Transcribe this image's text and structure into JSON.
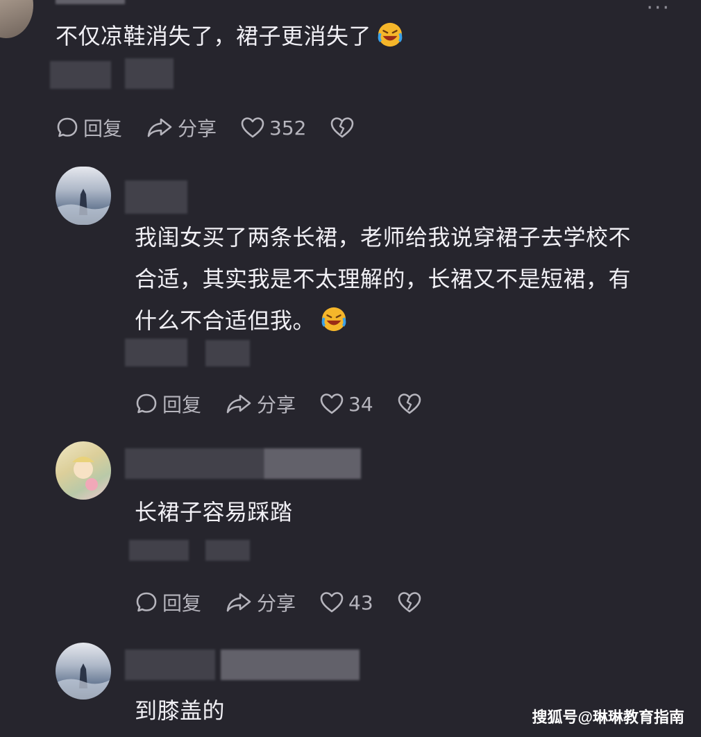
{
  "comments": [
    {
      "text": "不仅凉鞋消失了，裙子更消失了",
      "emoji": "laughing-crying-emoji",
      "reply_label": "回复",
      "share_label": "分享",
      "likes": "352"
    },
    {
      "text_lines": [
        "我闺女买了两条长裙，老师给我说穿裙子去学校不",
        "合适，其实我是不太理解的，长裙又不是短裙，有",
        "什么不合适但我。"
      ],
      "emoji": "laughing-crying-emoji",
      "reply_label": "回复",
      "share_label": "分享",
      "likes": "34"
    },
    {
      "text": "长裙子容易踩踏",
      "reply_label": "回复",
      "share_label": "分享",
      "likes": "43"
    },
    {
      "text": "到膝盖的"
    }
  ],
  "watermark": "搜狐号@琳琳教育指南",
  "colors": {
    "background": "#26252d",
    "text": "#f1f0f5",
    "muted": "#b6b5bd",
    "emoji": "#f5a623"
  }
}
